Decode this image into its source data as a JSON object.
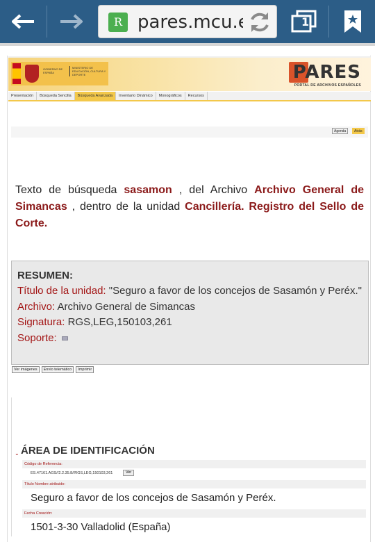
{
  "browser": {
    "url": "pares.mcu.e",
    "tab_count": "1",
    "favicon_letter": "R"
  },
  "banner": {
    "gov_text_1": "GOBIERNO DE ESPAÑA",
    "gov_text_2": "MINISTERIO DE EDUCACIÓN, CULTURA Y DEPORTE",
    "pares_word": "PARES",
    "pares_sub": "PORTAL DE ARCHIVOS ESPAÑOLES"
  },
  "nav": {
    "items": [
      "Presentación",
      "Búsqueda Sencilla",
      "Búsqueda Avanzada",
      "Inventario Dinámico",
      "Monográficos",
      "Recursos"
    ],
    "active_index": 2
  },
  "tools": {
    "agenda": "Agenda",
    "atras": "Atrás"
  },
  "search": {
    "prefix": "Texto de búsqueda",
    "term": "sasamon",
    "mid": ", del Archivo",
    "archive": "Archivo General de Simancas",
    "mid2": ", dentro de la unidad",
    "unit": "Cancillería. Registro del Sello de Corte."
  },
  "resumen": {
    "title": "RESUMEN:",
    "titulo_label": "Título de la unidad:",
    "titulo_value": "\"Seguro a favor de los concejos de Sasamón y Peréx.\"",
    "archivo_label": "Archivo:",
    "archivo_value": "Archivo General de Simancas",
    "signatura_label": "Signatura:",
    "signatura_value": "RGS,LEG,150103,261",
    "soporte_label": "Soporte:"
  },
  "actions": {
    "ver_imagenes": "Ver imágenes",
    "envio": "Envío telemático",
    "imprimir": "Imprimir"
  },
  "identificacion": {
    "title": "ÁREA DE IDENTIFICACIÓN",
    "codigo_label": "Código de Referencia:",
    "codigo_value": "ES.47161.AGS//2.2.35.8//RGS,LEG,150103,261",
    "ver": "Ver",
    "titulo_label": "Título Nombre atribuido:",
    "titulo_value": "Seguro a favor de los concejos de Sasamón y Peréx.",
    "fecha_label": "Fecha Creación:",
    "fecha_value": "1501-3-30 Valladolid (España)"
  },
  "colors": {
    "toolbar": "#2c5d87",
    "label_red": "#a31515",
    "highlight": "#8b1a1a",
    "nav_active": "#f3c84a"
  }
}
